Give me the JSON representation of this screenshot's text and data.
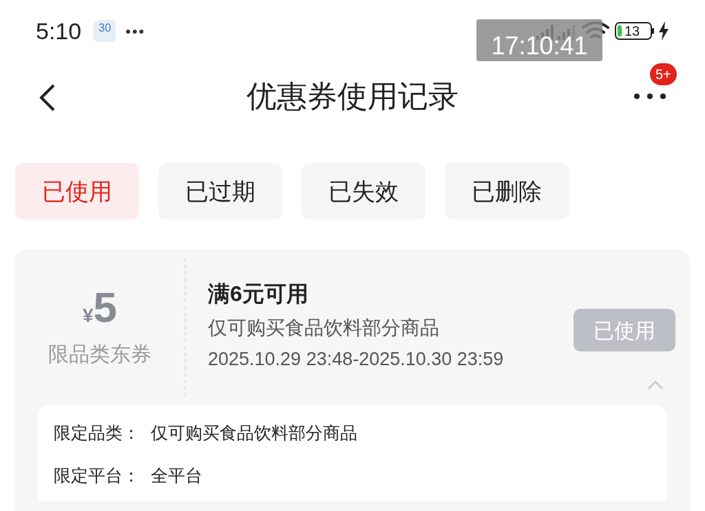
{
  "status_bar": {
    "time": "5:10",
    "calendar_day": "30",
    "more": "•••",
    "battery": "13",
    "overlay_time": "17:10:41"
  },
  "header": {
    "title": "优惠券使用记录",
    "badge": "5+"
  },
  "tabs": [
    {
      "label": "已使用",
      "selected": true
    },
    {
      "label": "已过期",
      "selected": false
    },
    {
      "label": "已失效",
      "selected": false
    },
    {
      "label": "已删除",
      "selected": false
    }
  ],
  "coupon": {
    "currency": "¥",
    "amount": "5",
    "type": "限品类东券",
    "title": "满6元可用",
    "scope": "仅可购买食品饮料部分商品",
    "period": "2025.10.29 23:48-2025.10.30 23:59",
    "status": "已使用",
    "expanded": true,
    "details": [
      {
        "label": "限定品类：",
        "value": "仅可购买食品饮料部分商品"
      },
      {
        "label": "限定平台：",
        "value": "全平台"
      }
    ]
  }
}
